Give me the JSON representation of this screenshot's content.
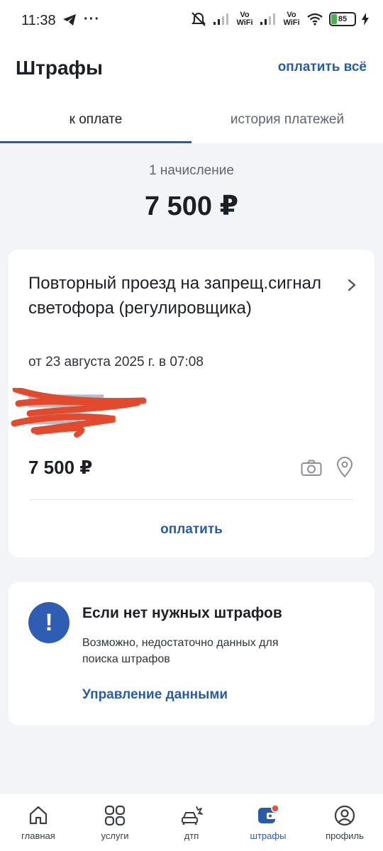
{
  "status_bar": {
    "time": "11:38",
    "dots": "···",
    "vo_wifi_1": "Vo WiFi",
    "vo_wifi_2": "Vo WiFi",
    "battery": "85"
  },
  "header": {
    "title": "Штрафы",
    "pay_all": "оплатить всё"
  },
  "tabs": [
    {
      "label": "к оплате",
      "active": true
    },
    {
      "label": "история платежей",
      "active": false
    }
  ],
  "summary": {
    "count": "1 начисление",
    "total": "7 500 ₽"
  },
  "fine": {
    "title": "Повторный проезд на запрещ.сигнал светофора (регулировщика)",
    "date": "от 23 августа 2025 г. в 07:08",
    "amount": "7 500 ₽",
    "pay_label": "оплатить"
  },
  "info": {
    "title": "Если нет нужных штрафов",
    "text": "Возможно, недостаточно данных для поиска штрафов",
    "link": "Управление данными"
  },
  "nav": [
    {
      "label": "главная",
      "icon": "home-icon"
    },
    {
      "label": "услуги",
      "icon": "grid-icon"
    },
    {
      "label": "дтп",
      "icon": "car-crash-icon"
    },
    {
      "label": "штрафы",
      "icon": "wallet-icon",
      "active": true
    },
    {
      "label": "профиль",
      "icon": "profile-icon"
    }
  ],
  "colors": {
    "accent": "#2a5ba6",
    "info_badge": "#2f5db3",
    "notification_dot": "#e5533f",
    "redaction": "#e24a2e"
  }
}
